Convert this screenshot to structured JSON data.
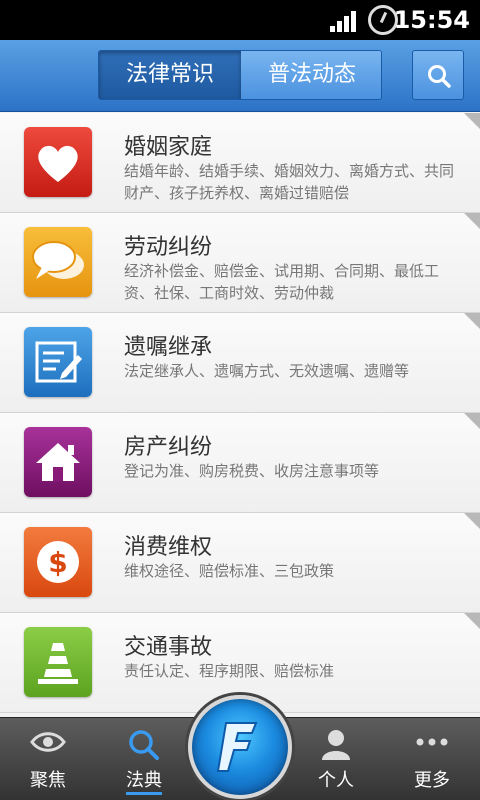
{
  "status_bar": {
    "time": "15:54"
  },
  "header": {
    "tabs": [
      {
        "label": "法律常识",
        "active": true
      },
      {
        "label": "普法动态",
        "active": false
      }
    ],
    "search_icon": "search-icon"
  },
  "categories": [
    {
      "title": "婚姻家庭",
      "desc": "结婚年龄、结婚手续、婚姻效力、离婚方式、共同财产、孩子抚养权、离婚过错赔偿",
      "icon": "heart-icon",
      "color": "#d9261c"
    },
    {
      "title": "劳动纠纷",
      "desc": "经济补偿金、赔偿金、试用期、合同期、最低工资、社保、工商时效、劳动仲裁",
      "icon": "chat-bubbles-icon",
      "color": "#f0a012"
    },
    {
      "title": "遗嘱继承",
      "desc": "法定继承人、遗嘱方式、无效遗嘱、遗赠等",
      "icon": "document-edit-icon",
      "color": "#2b7fc8"
    },
    {
      "title": "房产纠纷",
      "desc": "登记为准、购房税费、收房注意事项等",
      "icon": "house-icon",
      "color": "#8a1a78"
    },
    {
      "title": "消费维权",
      "desc": "维权途径、赔偿标准、三包政策",
      "icon": "dollar-coin-icon",
      "color": "#e7571a"
    },
    {
      "title": "交通事故",
      "desc": "责任认定、程序期限、赔偿标准",
      "icon": "traffic-cone-icon",
      "color": "#6ab52b"
    }
  ],
  "bottom_nav": {
    "items": [
      {
        "label": "聚焦",
        "icon": "eye-icon"
      },
      {
        "label": "法典",
        "icon": "search-icon",
        "active": true
      },
      {
        "label": "个人",
        "icon": "person-icon"
      },
      {
        "label": "更多",
        "icon": "more-dots-icon"
      }
    ],
    "center_icon": "f-logo-icon"
  }
}
